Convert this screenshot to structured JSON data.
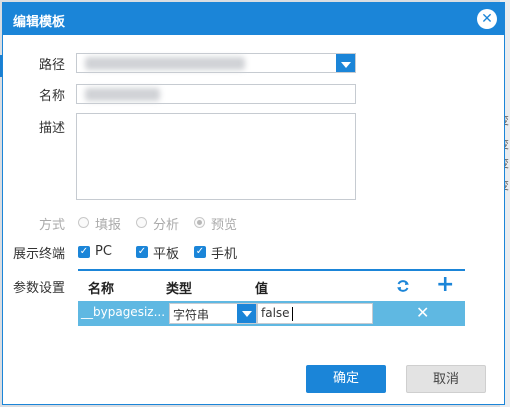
{
  "dialog": {
    "title": "编辑模板",
    "close_icon": "close-icon"
  },
  "form": {
    "path_label": "路径",
    "name_label": "名称",
    "desc_label": "描述",
    "mode_label": "方式",
    "mode_options": [
      "填报",
      "分析",
      "预览"
    ],
    "mode_selected": "预览",
    "terminal_label": "展示终端",
    "terminals": [
      "PC",
      "平板",
      "手机"
    ],
    "params_label": "参数设置"
  },
  "params": {
    "headers": {
      "name": "名称",
      "type": "类型",
      "value": "值"
    },
    "refresh_icon": "refresh-icon",
    "add_icon": "plus-icon",
    "rows": [
      {
        "name": "__bypagesiz...",
        "type": "字符串",
        "value": "false",
        "delete_icon": "close-icon"
      }
    ]
  },
  "buttons": {
    "ok": "确定",
    "cancel": "取消"
  },
  "background": {
    "glyphs": [
      "变",
      "变",
      "变",
      "变"
    ]
  },
  "colors": {
    "accent": "#1b85d8",
    "row_highlight": "#5fb8e2"
  }
}
